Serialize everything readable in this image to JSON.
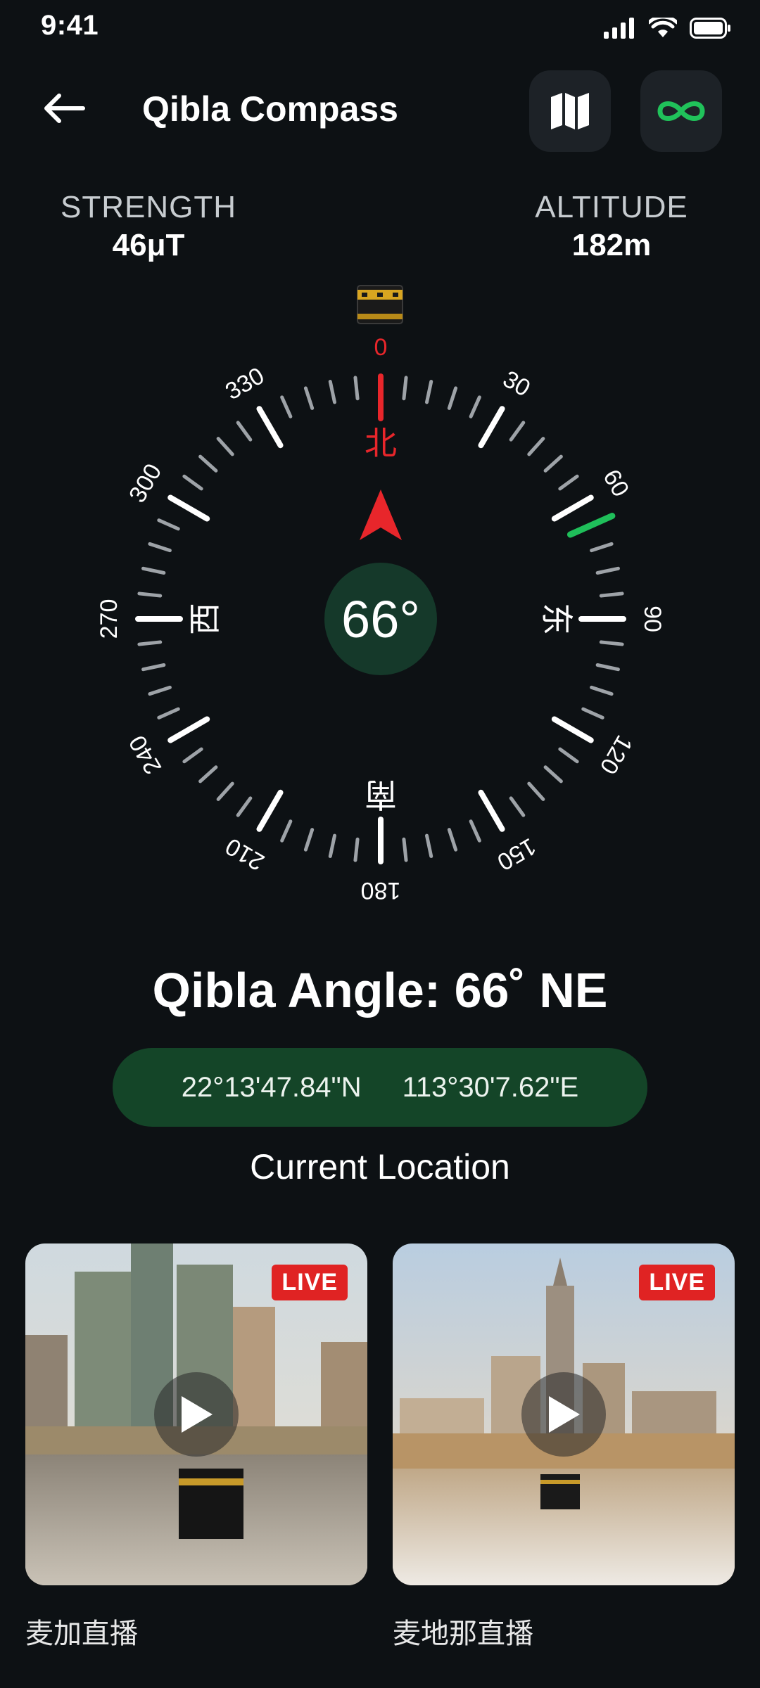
{
  "status_bar": {
    "time": "9:41",
    "icons": [
      "signal-icon",
      "wifi-icon",
      "battery-icon"
    ]
  },
  "header": {
    "title": "Qibla Compass",
    "back_icon": "arrow-left-icon",
    "map_icon": "map-icon",
    "loop_icon": "infinity-icon"
  },
  "stats": {
    "strength": {
      "label": "STRENGTH",
      "value": "46μT"
    },
    "altitude": {
      "label": "ALTITUDE",
      "value": "182m"
    }
  },
  "compass": {
    "heading_value": "66°",
    "qibla_marker_deg": 66,
    "degree_labels": [
      "0",
      "30",
      "60",
      "90",
      "120",
      "150",
      "180",
      "210",
      "240",
      "270",
      "300",
      "330"
    ],
    "cardinal": {
      "north": "北",
      "east": "东",
      "south": "南",
      "west": "西"
    },
    "accent_red": "#e8262b",
    "accent_green": "#1fbf5a",
    "kaaba_icon": "kaaba-icon"
  },
  "qibla": {
    "angle_text": "Qibla Angle: 66˚ NE"
  },
  "location": {
    "lat": "22°13'47.84\"N",
    "lon": "113°30'7.62\"E",
    "label": "Current Location"
  },
  "streams": [
    {
      "title": "麦加直播",
      "badge": "LIVE"
    },
    {
      "title": "麦地那直播",
      "badge": "LIVE"
    }
  ]
}
